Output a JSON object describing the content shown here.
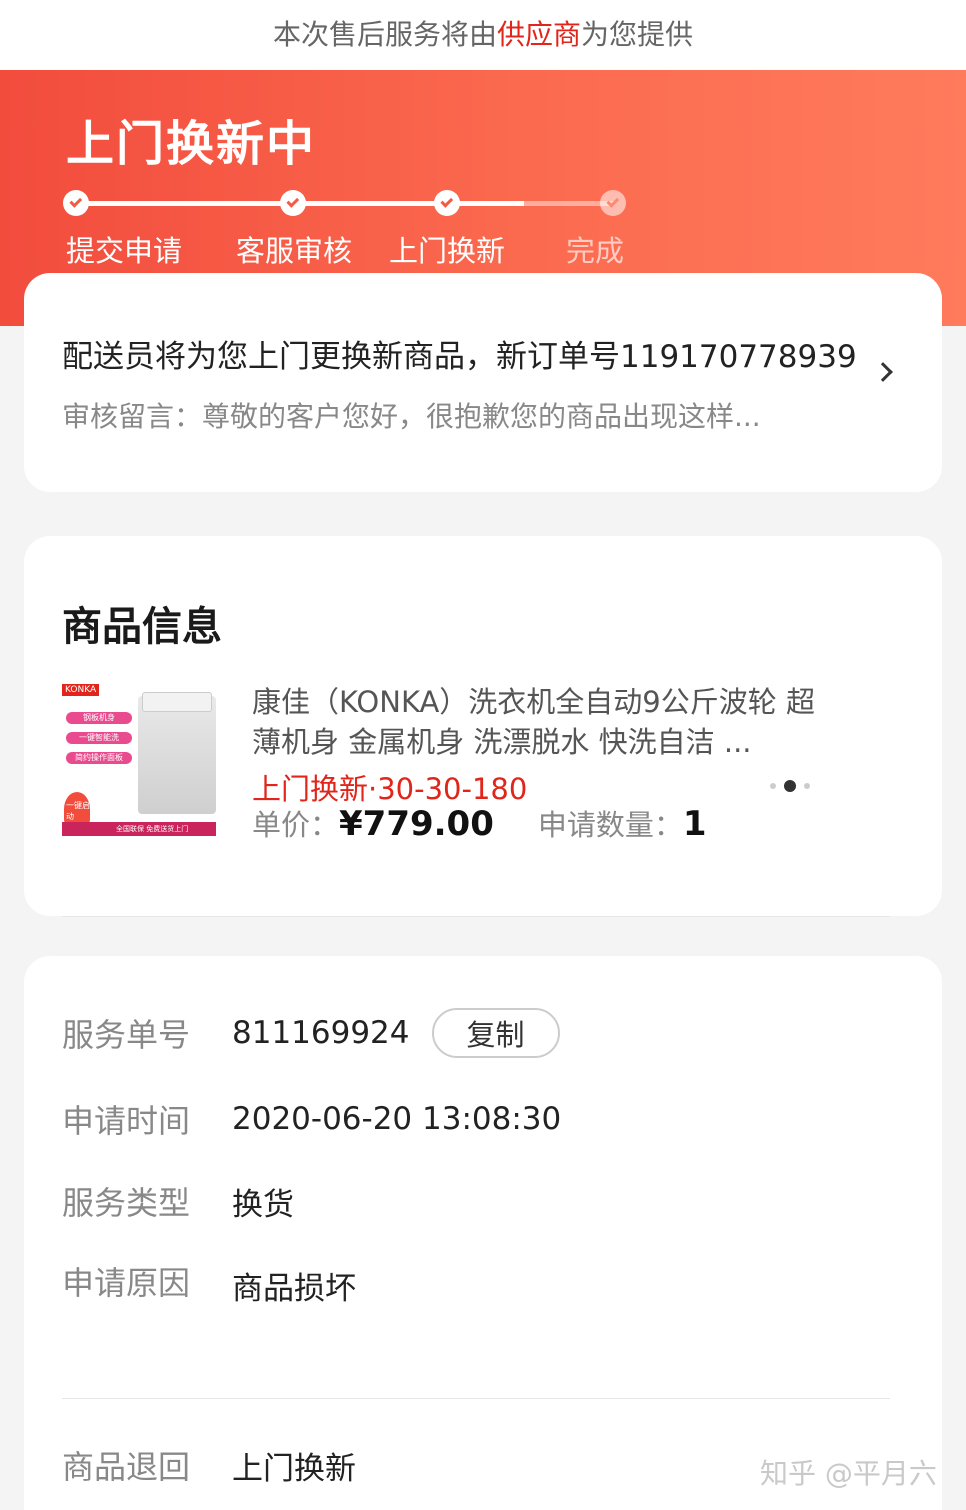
{
  "notice": {
    "prefix": "本次售后服务将由",
    "highlight": "供应商",
    "suffix": "为您提供"
  },
  "header": {
    "title": "上门换新中",
    "steps": [
      {
        "label": "提交申请",
        "done": true
      },
      {
        "label": "客服审核",
        "done": true
      },
      {
        "label": "上门换新",
        "done": true
      },
      {
        "label": "完成",
        "done": false
      }
    ]
  },
  "status": {
    "main": "配送员将为您上门更换新商品，新订单号119170778939",
    "sub": "审核留言：尊敬的客户您好，很抱歉您的商品出现这样..."
  },
  "product_section": {
    "title": "商品信息",
    "image_texts": {
      "brand": "KONKA",
      "tags": [
        "钢板机身",
        "一键智能洗",
        "简约操作面板"
      ],
      "flame": "一键启动",
      "base": "全国联保 免费送货上门"
    },
    "name": "康佳（KONKA）洗衣机全自动9公斤波轮 超薄机身 金属机身 洗漂脱水 快洗自洁 ...",
    "tag": "上门换新·30-30-180",
    "price_label": "单价：",
    "price": "¥779.00",
    "qty_label": "申请数量：",
    "qty": "1"
  },
  "info": {
    "service_no": {
      "label": "服务单号",
      "value": "811169924",
      "copy_label": "复制"
    },
    "apply_time": {
      "label": "申请时间",
      "value": "2020-06-20 13:08:30"
    },
    "service_type": {
      "label": "服务类型",
      "value": "换货"
    },
    "apply_reason": {
      "label": "申请原因",
      "value": "商品损坏"
    },
    "return_method": {
      "label": "商品退回",
      "value": "上门换新"
    }
  },
  "watermark": "知乎 @平月六",
  "colors": {
    "accent": "#e1251b",
    "header_start": "#f24c3d",
    "header_end": "#ff7b5c"
  }
}
